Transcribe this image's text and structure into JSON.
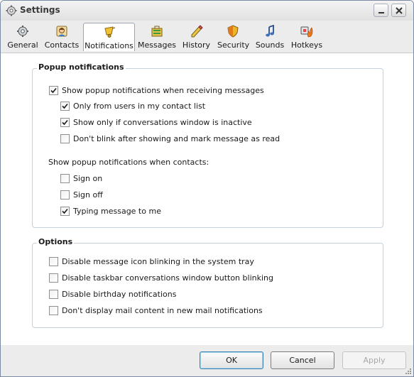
{
  "window": {
    "title": "Settings"
  },
  "tabs": [
    {
      "label": "General",
      "icon": "gear-icon",
      "active": false
    },
    {
      "label": "Contacts",
      "icon": "contacts-icon",
      "active": false
    },
    {
      "label": "Notifications",
      "icon": "bell-icon",
      "active": true
    },
    {
      "label": "Messages",
      "icon": "messages-icon",
      "active": false
    },
    {
      "label": "History",
      "icon": "history-icon",
      "active": false
    },
    {
      "label": "Security",
      "icon": "shield-icon",
      "active": false
    },
    {
      "label": "Sounds",
      "icon": "music-note-icon",
      "active": false
    },
    {
      "label": "Hotkeys",
      "icon": "hotkeys-icon",
      "active": false
    }
  ],
  "popup": {
    "legend": "Popup notifications",
    "show_popup": {
      "label": "Show popup notifications when receiving messages",
      "checked": true
    },
    "only_contacts": {
      "label": "Only from users in my contact list",
      "checked": true
    },
    "only_inactive": {
      "label": "Show only if conversations window is inactive",
      "checked": true
    },
    "dont_blink": {
      "label": "Don't blink after showing and mark message as read",
      "checked": false
    },
    "contacts_heading": "Show popup notifications when contacts:",
    "sign_on": {
      "label": "Sign on",
      "checked": false
    },
    "sign_off": {
      "label": "Sign off",
      "checked": false
    },
    "typing": {
      "label": "Typing message to me",
      "checked": true
    }
  },
  "options": {
    "legend": "Options",
    "items": [
      {
        "label": "Disable message icon blinking in the system tray",
        "checked": false
      },
      {
        "label": "Disable taskbar conversations window button blinking",
        "checked": false
      },
      {
        "label": "Disable birthday notifications",
        "checked": false
      },
      {
        "label": "Don't display mail content in new mail notifications",
        "checked": false
      }
    ]
  },
  "buttons": {
    "ok": "OK",
    "cancel": "Cancel",
    "apply": "Apply"
  },
  "colors": {
    "accent": "#3c7fb1",
    "check": "#1a1a1a",
    "group_border": "#c6d0dc"
  }
}
